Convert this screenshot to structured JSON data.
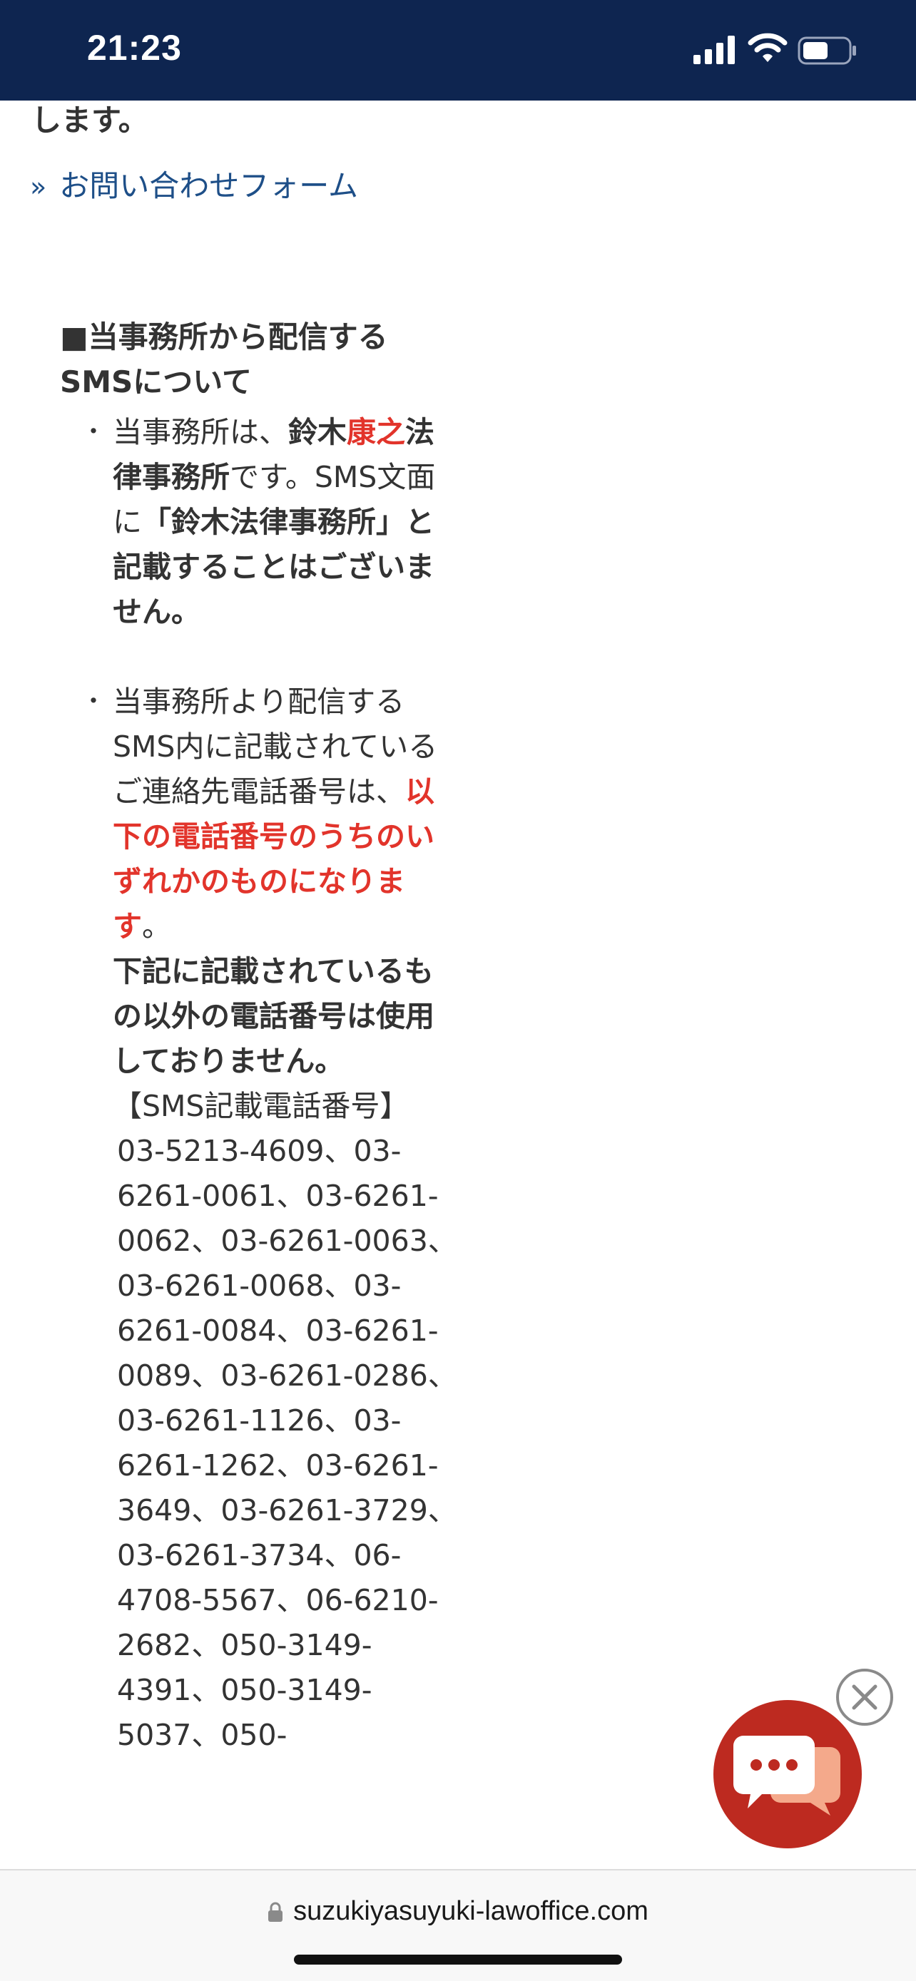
{
  "status_bar": {
    "time": "21:23",
    "icons": [
      "signal-icon",
      "wifi-icon",
      "battery-icon"
    ],
    "bg_color": "#0e2550"
  },
  "page": {
    "cut_text": "します。",
    "contact_link": {
      "chevron": "»",
      "label": "お問い合わせフォーム"
    },
    "section": {
      "heading_line1": "■当事務所から配信する",
      "heading_line2": "SMSについて",
      "bullet1": {
        "t1": "当事務所は、",
        "t2": "鈴木",
        "t3": "康之",
        "t4": "法律事務所",
        "t5": "です。SMS文面に",
        "t6": "「鈴木法律事務所」と記載することはございません。"
      },
      "bullet2": {
        "t1": "当事務所より配信するSMS内に記載されているご連絡先電話番号は、",
        "t2": "以下の電話番号のうちのいずれかのものになります",
        "t3": "。",
        "t4": "下記に記載されているもの以外の電話番号は使用しておりません。",
        "sms_label": "【SMS記載電話番号】",
        "phones": "03-5213-4609、03-6261-0061、03-6261-0062、03-6261-0063、03-6261-0068、03-6261-0084、03-6261-0089、03-6261-0286、03-6261-1126、03-6261-1262、03-6261-3649、03-6261-3729、03-6261-3734、06-4708-5567、06-6210-2682、050-3149-4391、050-3149-5037、050-"
      }
    },
    "accent_red": "#e2342b",
    "link_color": "#1e4f88"
  },
  "chat_widget": {
    "close_icon": "close-circle-icon",
    "chat_icon": "chat-bubbles-icon",
    "color": "#bd2a20"
  },
  "address_bar": {
    "url": "suzukiyasuyuki-lawoffice.com",
    "lock_icon": "lock-icon"
  }
}
